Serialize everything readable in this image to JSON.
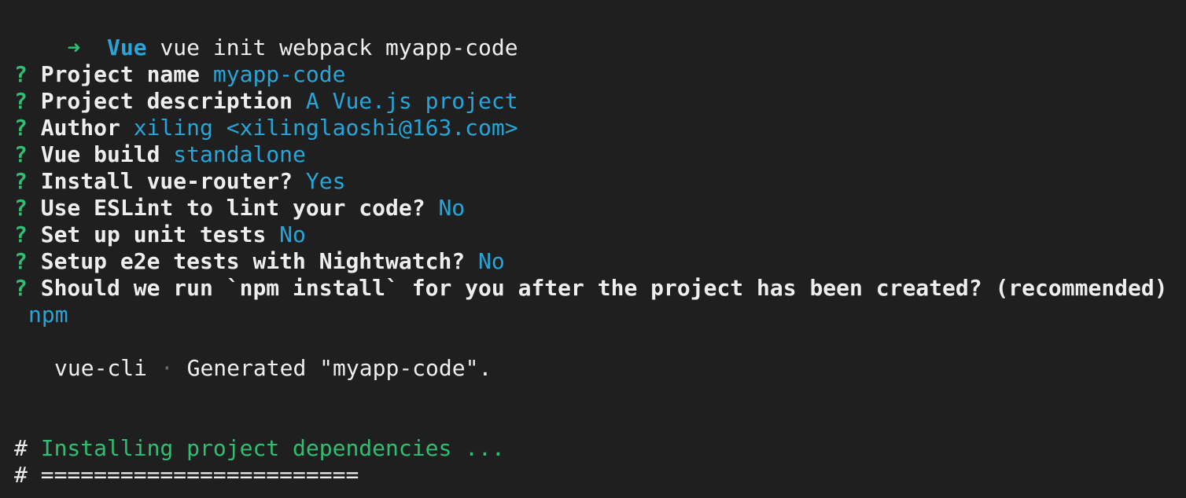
{
  "colors": {
    "background": "#1f1f1f",
    "text": "#eeeeee",
    "prompt_arrow": "#2fbf71",
    "answer_cyan": "#27a5d8",
    "status_green": "#2fbf71"
  },
  "command": {
    "arrow": "➜",
    "dir": "Vue",
    "text": "vue init webpack myapp-code"
  },
  "prompts": [
    {
      "mark": "?",
      "question": "Project name",
      "answer": "myapp-code"
    },
    {
      "mark": "?",
      "question": "Project description",
      "answer": "A Vue.js project"
    },
    {
      "mark": "?",
      "question": "Author",
      "answer": "xiling <xilinglaoshi@163.com>"
    },
    {
      "mark": "?",
      "question": "Vue build",
      "answer": "standalone"
    },
    {
      "mark": "?",
      "question": "Install vue-router?",
      "answer": "Yes"
    },
    {
      "mark": "?",
      "question": "Use ESLint to lint your code?",
      "answer": "No"
    },
    {
      "mark": "?",
      "question": "Set up unit tests",
      "answer": "No"
    },
    {
      "mark": "?",
      "question": "Setup e2e tests with Nightwatch?",
      "answer": "No"
    },
    {
      "mark": "?",
      "question": "Should we run `npm install` for you after the project has been created? (recommended)",
      "answer": "npm"
    }
  ],
  "generated": {
    "tool": "vue-cli",
    "separator": "·",
    "message": "Generated \"myapp-code\"."
  },
  "install": {
    "hash": "#",
    "status": "Installing project dependencies ...",
    "underline": "========================"
  }
}
